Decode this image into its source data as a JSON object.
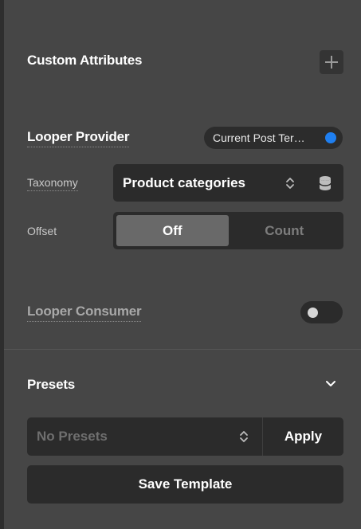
{
  "custom_attributes": {
    "title": "Custom Attributes",
    "add_icon": "plus-icon"
  },
  "looper_provider": {
    "title": "Looper Provider",
    "source_value": "Current Post Ter…",
    "toggle_color": "#1f7ff0"
  },
  "taxonomy": {
    "label": "Taxonomy",
    "value": "Product categories",
    "icons": [
      "chevron-up-down-icon",
      "database-icon"
    ]
  },
  "offset": {
    "label": "Offset",
    "options": [
      {
        "label": "Off",
        "active": true
      },
      {
        "label": "Count",
        "active": false
      }
    ]
  },
  "looper_consumer": {
    "title": "Looper Consumer",
    "enabled": false
  },
  "presets": {
    "title": "Presets",
    "select_value": "No Presets",
    "apply_label": "Apply",
    "save_label": "Save Template"
  }
}
